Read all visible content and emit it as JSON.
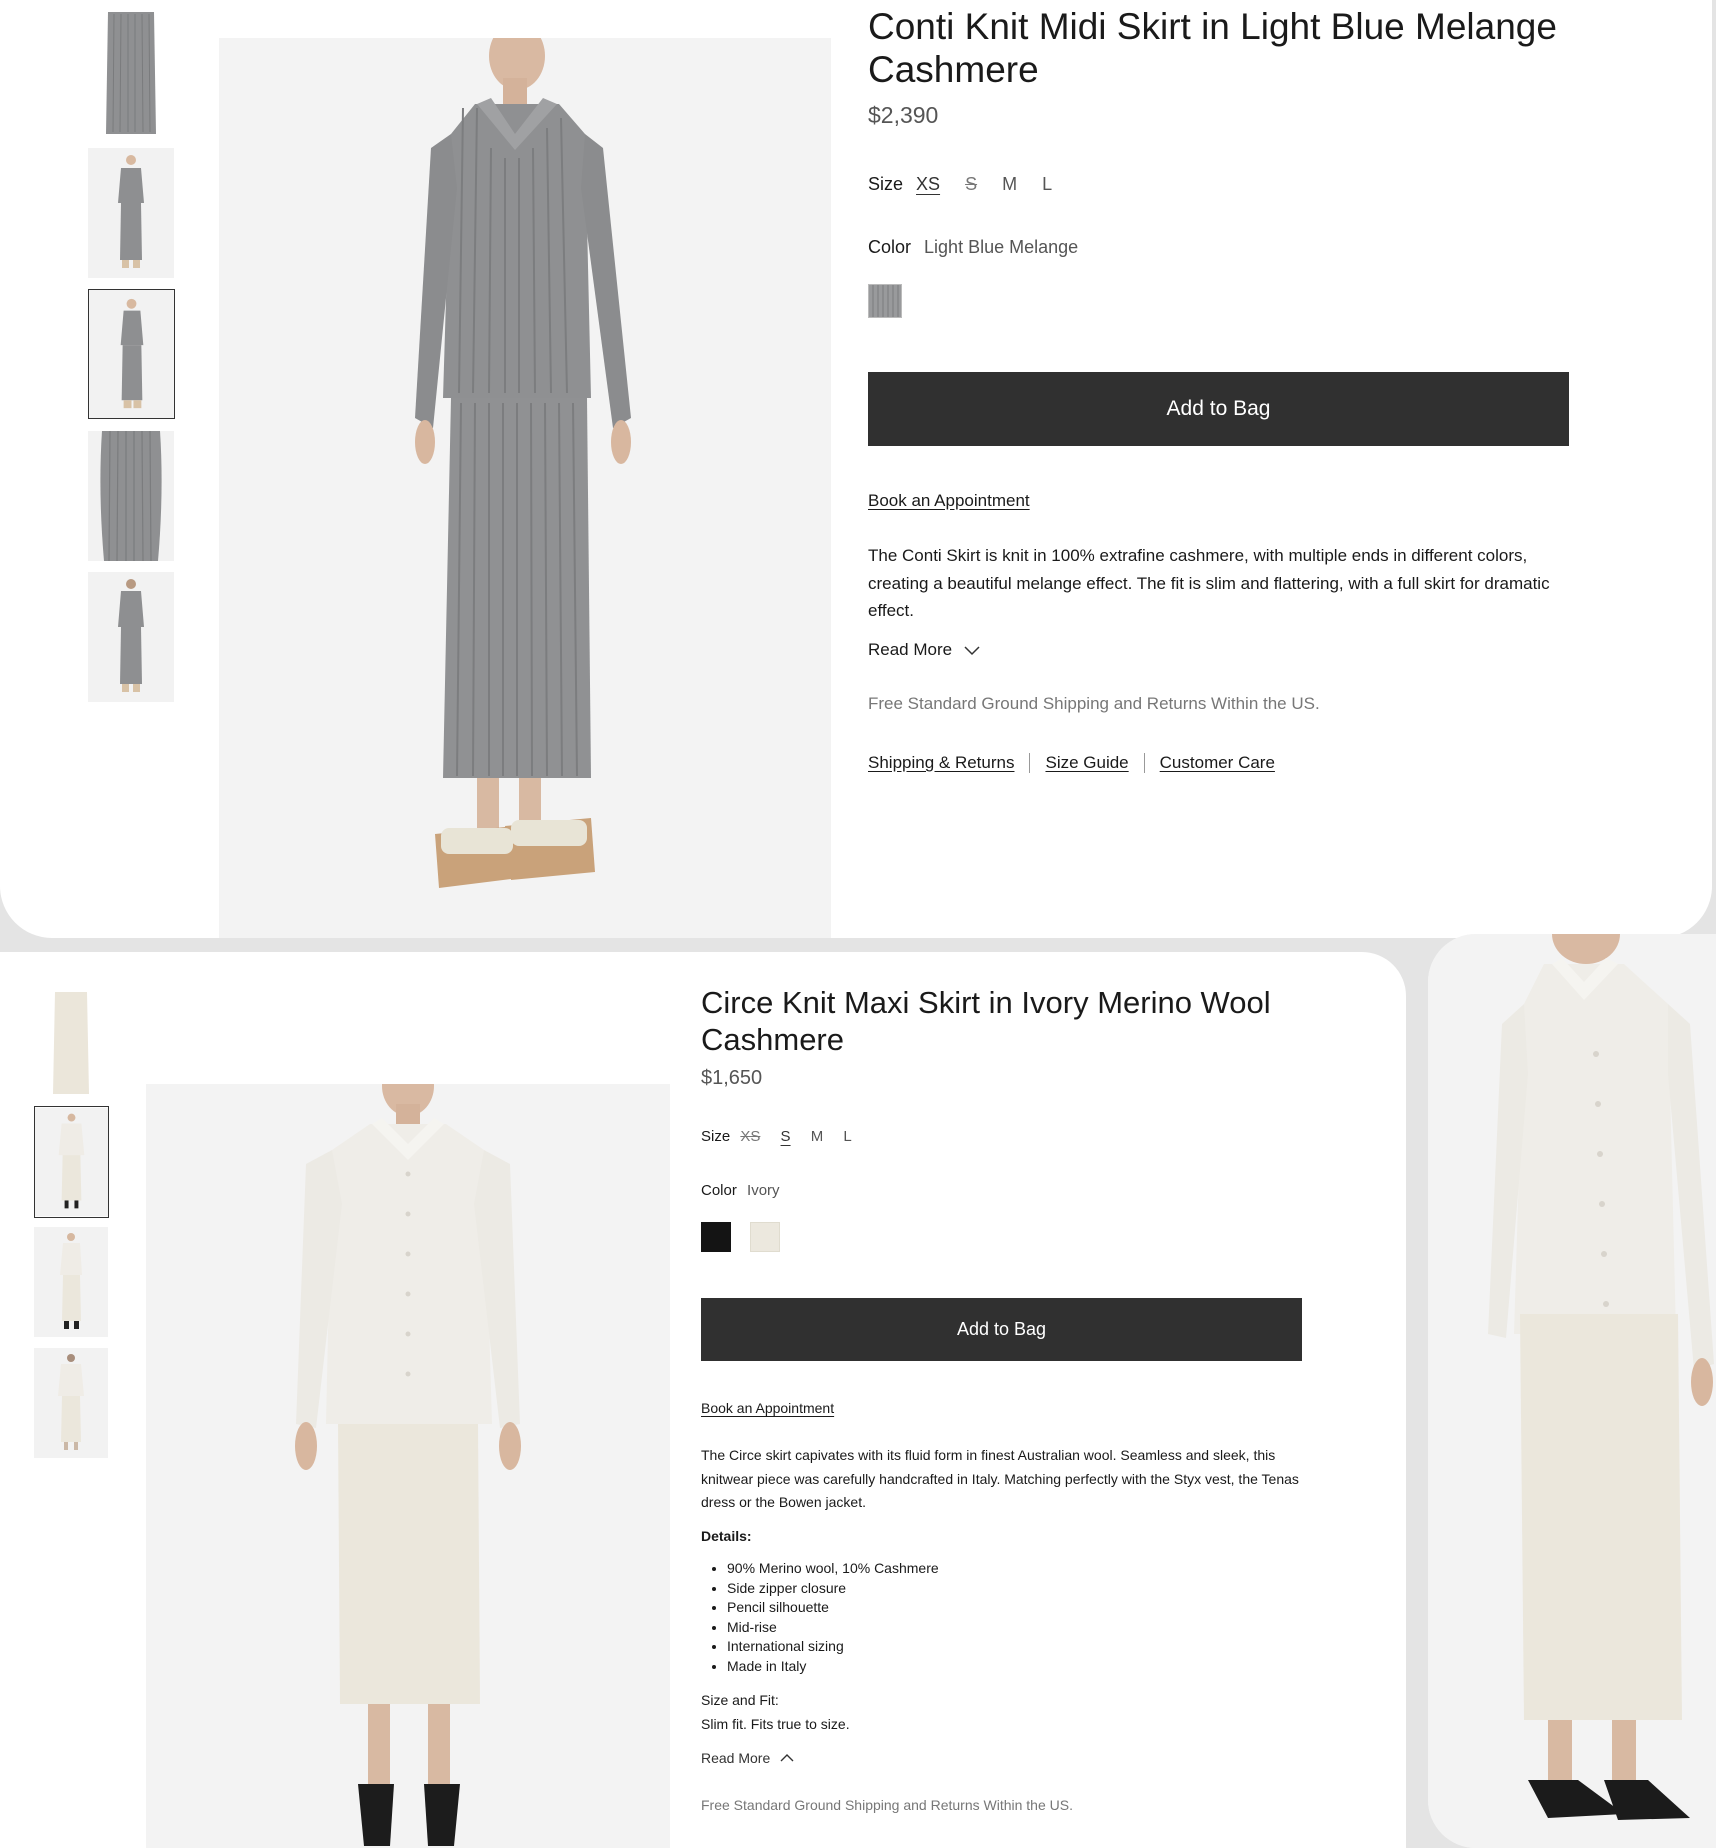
{
  "product1": {
    "title_line1": "Conti Knit Midi Skirt in Light Blue Melange",
    "title_line2": "Cashmere",
    "price": "$2,390",
    "size_label": "Size",
    "sizes": [
      "XS",
      "S",
      "M",
      "L"
    ],
    "selected_size": "XS",
    "unavailable_sizes": [
      "S"
    ],
    "color_label": "Color",
    "color_value": "Light Blue Melange",
    "swatches": [
      {
        "name": "light-blue-melange",
        "color": "#9a9b9d"
      }
    ],
    "add_to_bag": "Add to Bag",
    "book_appointment": "Book an Appointment",
    "description": "The Conti Skirt is knit in 100% extrafine cashmere, with multiple ends in different colors, creating a beautiful melange effect. The fit is slim and flattering, with a full skirt for dramatic effect.",
    "read_more": "Read More",
    "shipping_note": "Free Standard Ground Shipping and Returns Within the US.",
    "links": [
      "Shipping & Returns",
      "Size Guide",
      "Customer Care"
    ],
    "thumbnails": [
      "skirt-flat",
      "model-front",
      "model-side",
      "skirt-detail",
      "model-back"
    ],
    "selected_thumbnail": 2
  },
  "product2": {
    "title_line1": "Circe Knit Maxi Skirt in Ivory Merino Wool",
    "title_line2": "Cashmere",
    "price": "$1,650",
    "size_label": "Size",
    "sizes": [
      "XS",
      "S",
      "M",
      "L"
    ],
    "selected_size": "S",
    "unavailable_sizes": [
      "XS"
    ],
    "color_label": "Color",
    "color_value": "Ivory",
    "swatches": [
      {
        "name": "black",
        "color": "#141414"
      },
      {
        "name": "ivory",
        "color": "#ece8de"
      }
    ],
    "add_to_bag": "Add to Bag",
    "book_appointment": "Book an Appointment",
    "description": "The Circe skirt capivates with its fluid form in finest Australian wool. Seamless and sleek, this knitwear piece was carefully handcrafted in Italy. Matching perfectly with the Styx vest, the Tenas dress or the Bowen jacket.",
    "details_heading": "Details:",
    "details": [
      "90% Merino wool, 10% Cashmere",
      "Side zipper closure",
      "Pencil silhouette",
      "Mid-rise",
      "International sizing",
      "Made in Italy"
    ],
    "size_fit_heading": "Size and Fit:",
    "size_fit_text": "Slim fit. Fits true to size.",
    "read_more": "Read More",
    "shipping_note": "Free Standard Ground Shipping and Returns Within the US.",
    "thumbnails": [
      "skirt-flat",
      "model-front",
      "model-side",
      "model-back"
    ],
    "selected_thumbnail": 1
  },
  "colors": {
    "button_bg": "#303030",
    "gray_knit": "#8f9092",
    "ivory_knit": "#ece8dd"
  }
}
